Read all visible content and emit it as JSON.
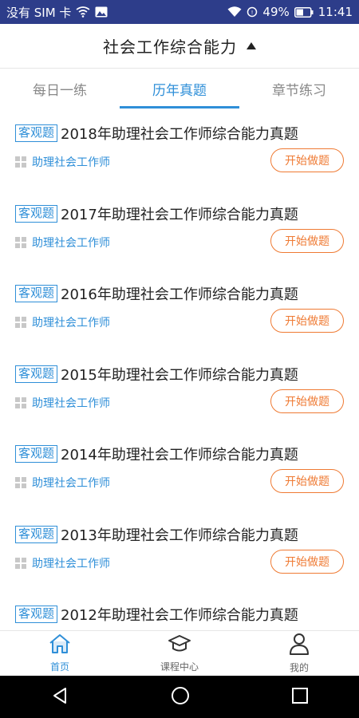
{
  "status_bar": {
    "carrier": "没有 SIM 卡",
    "battery": "49%",
    "time": "11:41"
  },
  "header": {
    "title": "社会工作综合能力"
  },
  "tabs": [
    {
      "label": "每日一练"
    },
    {
      "label": "历年真题"
    },
    {
      "label": "章节练习"
    }
  ],
  "list": {
    "items": [
      {
        "tag": "客观题",
        "title": "2018年助理社会工作师综合能力真题",
        "subtitle": "助理社会工作师",
        "button": "开始做题"
      },
      {
        "tag": "客观题",
        "title": "2017年助理社会工作师综合能力真题",
        "subtitle": "助理社会工作师",
        "button": "开始做题"
      },
      {
        "tag": "客观题",
        "title": "2016年助理社会工作师综合能力真题",
        "subtitle": "助理社会工作师",
        "button": "开始做题"
      },
      {
        "tag": "客观题",
        "title": "2015年助理社会工作师综合能力真题",
        "subtitle": "助理社会工作师",
        "button": "开始做题"
      },
      {
        "tag": "客观题",
        "title": "2014年助理社会工作师综合能力真题",
        "subtitle": "助理社会工作师",
        "button": "开始做题"
      },
      {
        "tag": "客观题",
        "title": "2013年助理社会工作师综合能力真题",
        "subtitle": "助理社会工作师",
        "button": "开始做题"
      },
      {
        "tag": "客观题",
        "title": "2012年助理社会工作师综合能力真题"
      }
    ]
  },
  "bottom_nav": [
    {
      "label": "首页",
      "icon": "home-icon"
    },
    {
      "label": "课程中心",
      "icon": "graduation-cap-icon"
    },
    {
      "label": "我的",
      "icon": "user-icon"
    }
  ],
  "colors": {
    "status_bar": "#2d3d8a",
    "accent": "#2f8fd8",
    "button": "#ef7a33"
  }
}
